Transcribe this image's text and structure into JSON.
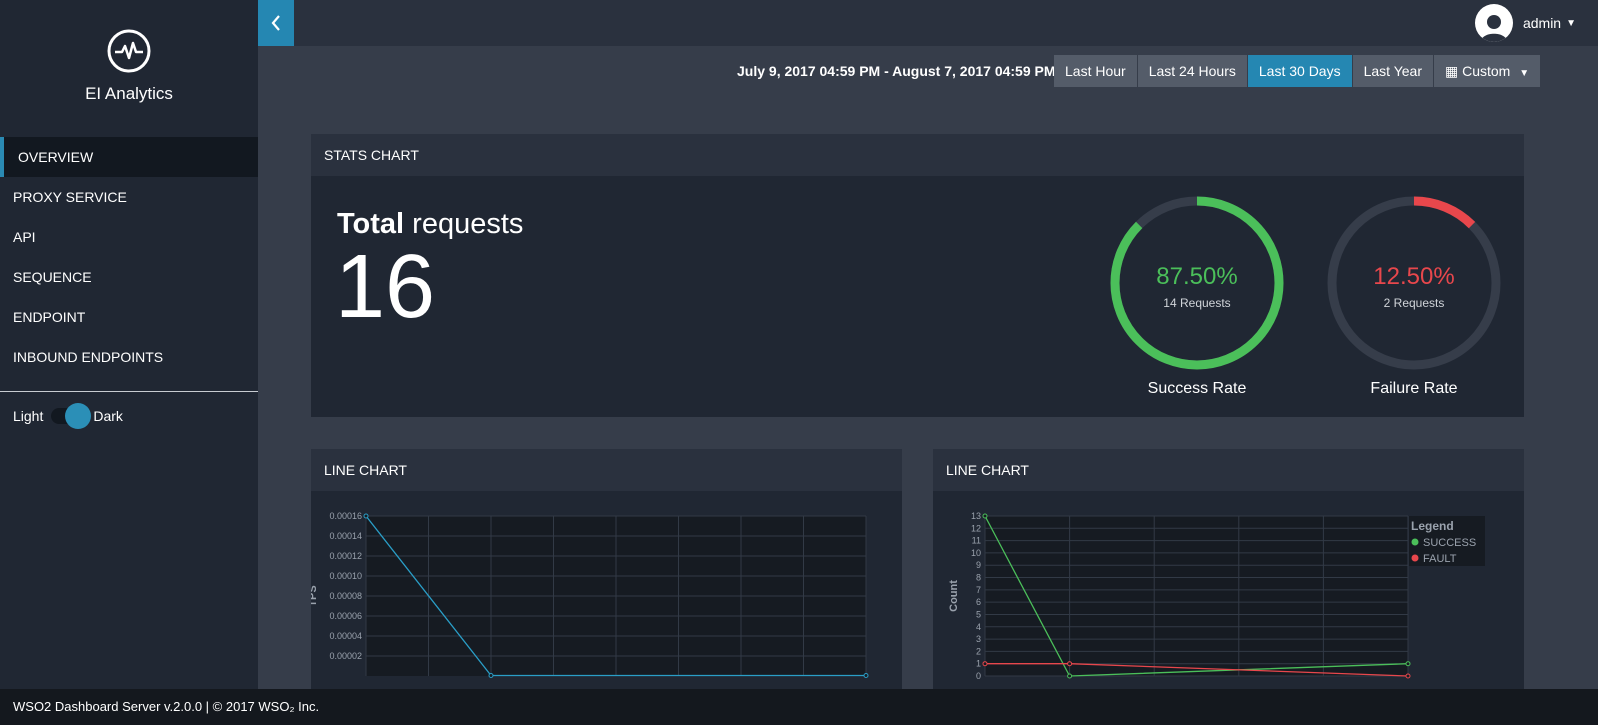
{
  "app": {
    "title": "EI Analytics"
  },
  "sidebar": {
    "items": [
      {
        "label": "OVERVIEW",
        "active": true
      },
      {
        "label": "PROXY SERVICE"
      },
      {
        "label": "API"
      },
      {
        "label": "SEQUENCE"
      },
      {
        "label": "ENDPOINT"
      },
      {
        "label": "INBOUND ENDPOINTS"
      }
    ],
    "theme": {
      "light_label": "Light",
      "dark_label": "Dark",
      "selected": "Dark"
    }
  },
  "topbar": {
    "user": "admin"
  },
  "date_filter": {
    "range_text": "July 9, 2017 04:59 PM - August 7, 2017 04:59 PM",
    "buttons": [
      "Last Hour",
      "Last 24 Hours",
      "Last 30 Days",
      "Last Year",
      "Custom"
    ],
    "active": "Last 30 Days"
  },
  "stats": {
    "title": "STATS CHART",
    "total_label_bold": "Total",
    "total_label_rest": " requests",
    "total_value": "16",
    "success": {
      "percent": "87.50%",
      "requests": "14 Requests",
      "label": "Success Rate",
      "fraction": 0.875,
      "color": "#4bbf5a"
    },
    "failure": {
      "percent": "12.50%",
      "requests": "2 Requests",
      "label": "Failure Rate",
      "fraction": 0.125,
      "color": "#e8474c"
    }
  },
  "charts": {
    "left_title": "LINE CHART",
    "right_title": "LINE CHART"
  },
  "chart_data": [
    {
      "type": "line",
      "title": "LINE CHART",
      "ylabel": "TPS",
      "yticks": [
        "0.00002",
        "0.00004",
        "0.00006",
        "0.00008",
        "0.00010",
        "0.00012",
        "0.00014",
        "0.00016"
      ],
      "ylim": [
        0,
        0.00016
      ],
      "series": [
        {
          "values": [
            0.00016,
            5e-07,
            5e-07
          ],
          "x_index": [
            0,
            2,
            8
          ],
          "color": "#2a9ec7"
        }
      ],
      "x_count": 8,
      "grid": true
    },
    {
      "type": "line",
      "title": "LINE CHART",
      "ylabel": "Count",
      "yticks": [
        "0",
        "1",
        "2",
        "3",
        "4",
        "5",
        "6",
        "7",
        "8",
        "9",
        "10",
        "11",
        "12",
        "13"
      ],
      "ylim": [
        0,
        13
      ],
      "legend_title": "Legend",
      "legend_position": "top-right",
      "series": [
        {
          "name": "SUCCESS",
          "values": [
            13,
            0,
            1
          ],
          "x_index": [
            0,
            1,
            5
          ],
          "color": "#4bbf5a"
        },
        {
          "name": "FAULT",
          "values": [
            1,
            1,
            0
          ],
          "x_index": [
            0,
            1,
            5
          ],
          "color": "#e8474c"
        }
      ],
      "x_count": 5,
      "grid": true
    }
  ],
  "footer": {
    "text": "WSO2 Dashboard Server v.2.0.0 | © 2017 WSO₂ Inc."
  }
}
